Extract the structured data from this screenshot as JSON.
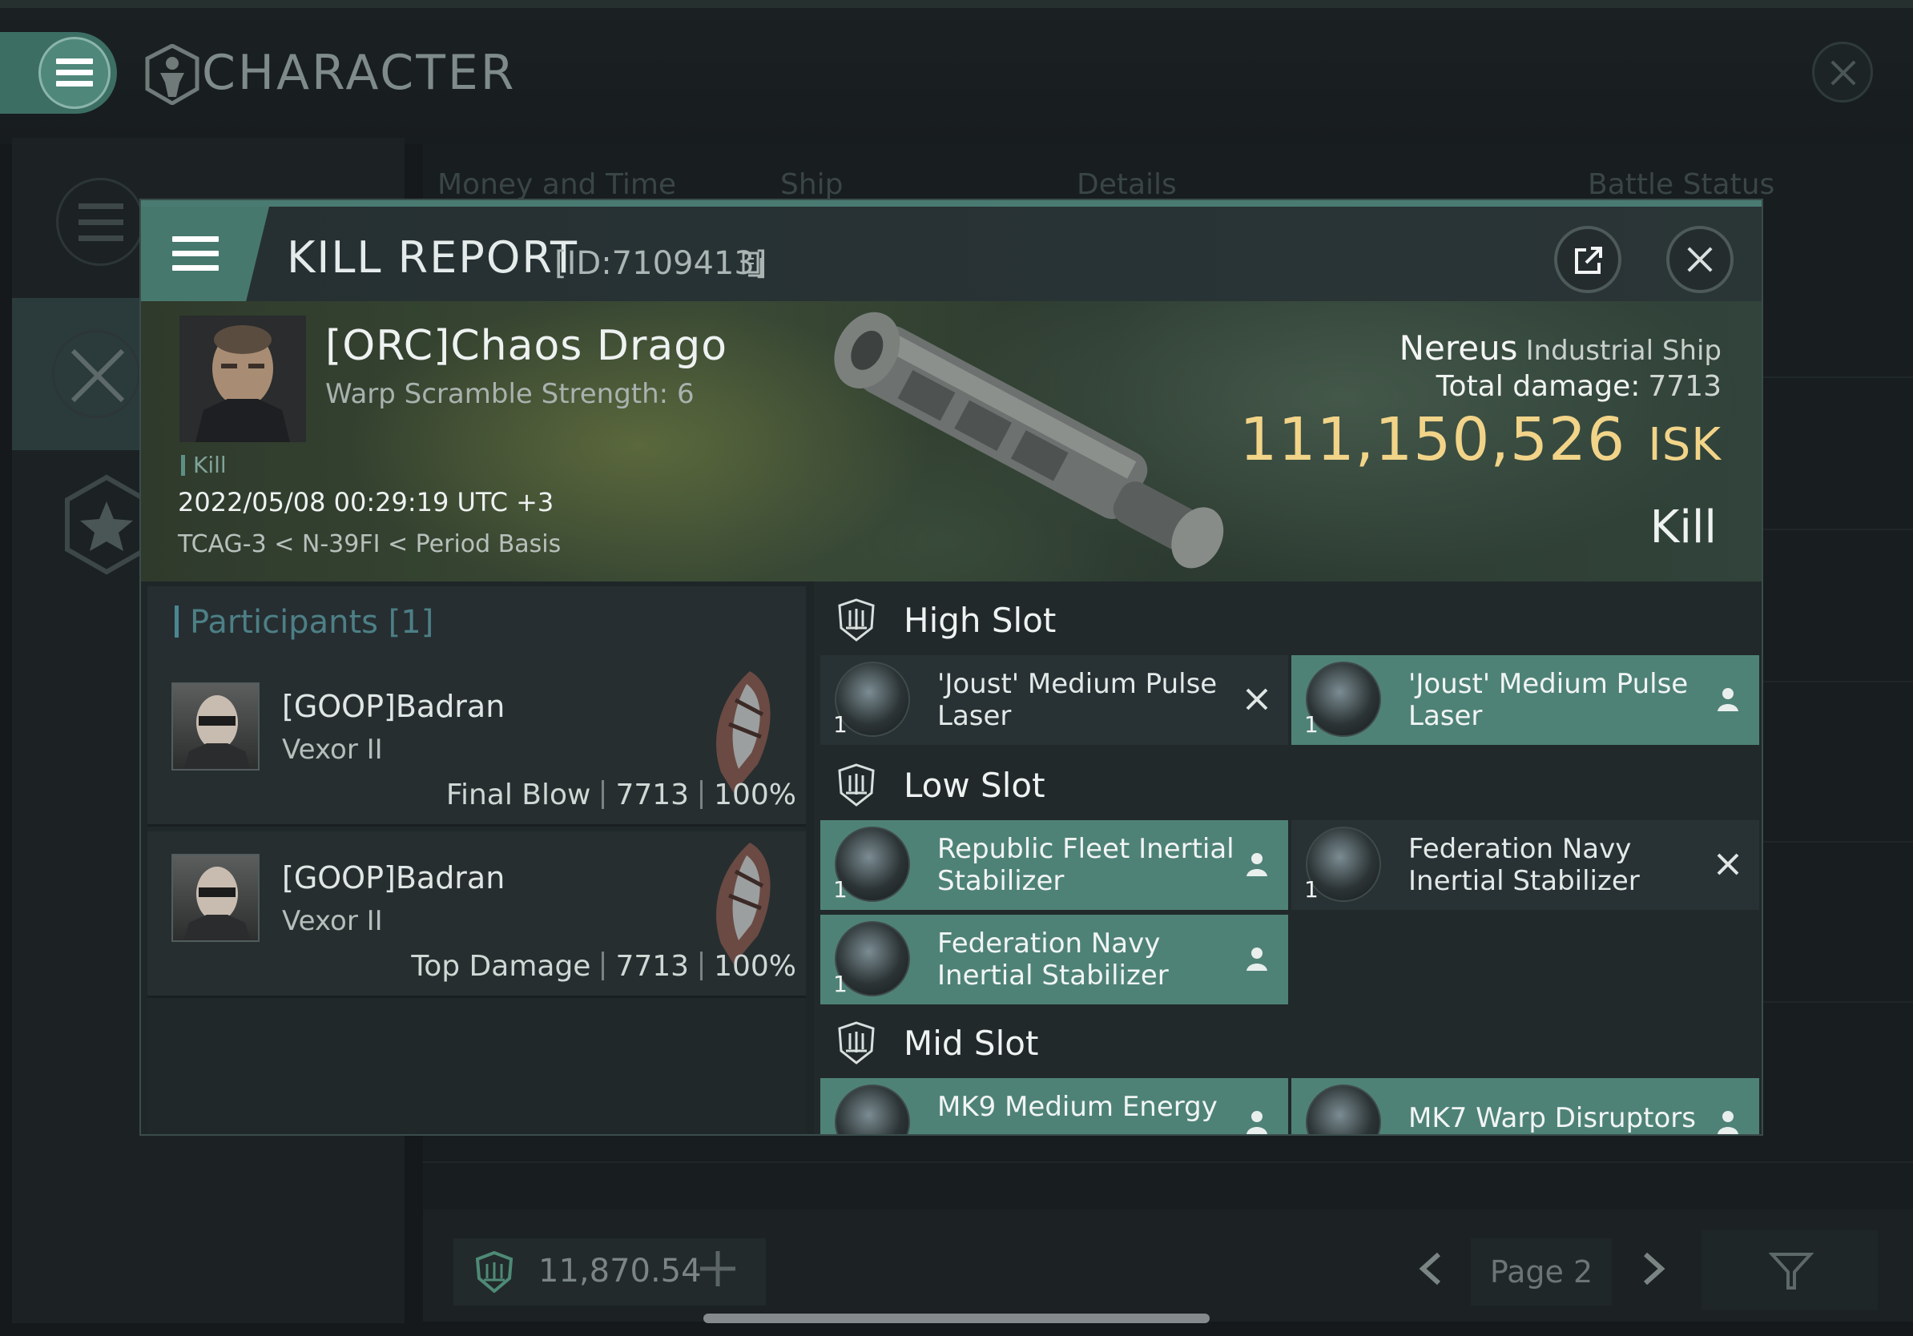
{
  "window": {
    "title": "CHARACTER"
  },
  "background": {
    "tabs": [
      "Money and Time",
      "Ship",
      "Details",
      "Battle Status"
    ],
    "wallet_value": "11,870.54",
    "page_label": "Page 2"
  },
  "kill_report": {
    "title": "KILL REPORT",
    "id_label": "[ID:7109413]",
    "victim": {
      "name": "[ORC]Chaos Drago",
      "subtitle": "Warp Scramble Strength: 6",
      "tag": "Kill",
      "datetime": "2022/05/08 00:29:19 UTC +3",
      "location": "TCAG-3 < N-39FI < Period Basis"
    },
    "ship": {
      "name": "Nereus",
      "class": "Industrial Ship",
      "total_damage_label": "Total damage:",
      "total_damage_value": "7713",
      "isk_value": "111,150,526",
      "isk_unit": "ISK",
      "result": "Kill"
    },
    "participants": {
      "title": "Participants [1]",
      "rows": [
        {
          "name": "[GOOP]Badran",
          "ship": "Vexor II",
          "role": "Final Blow",
          "damage": "7713",
          "percent": "100%"
        },
        {
          "name": "[GOOP]Badran",
          "ship": "Vexor II",
          "role": "Top Damage",
          "damage": "7713",
          "percent": "100%"
        }
      ]
    },
    "slots": {
      "high": {
        "label": "High Slot",
        "items": [
          {
            "name": "'Joust' Medium Pulse Laser",
            "qty": "1",
            "state": "destroyed"
          },
          {
            "name": "'Joust' Medium Pulse Laser",
            "qty": "1",
            "state": "dropped"
          }
        ]
      },
      "low": {
        "label": "Low Slot",
        "items": [
          {
            "name": "Republic Fleet Inertial Stabilizer",
            "qty": "1",
            "state": "dropped"
          },
          {
            "name": "Federation Navy Inertial Stabilizer",
            "qty": "1",
            "state": "destroyed"
          },
          {
            "name": "Federation Navy Inertial Stabilizer",
            "qty": "1",
            "state": "dropped"
          }
        ]
      },
      "mid": {
        "label": "Mid Slot",
        "items": [
          {
            "name": "MK9 Medium Energy",
            "qty": "",
            "state": "dropped"
          },
          {
            "name": "MK7 Warp Disruptors",
            "qty": "",
            "state": "dropped"
          }
        ]
      }
    }
  },
  "colors": {
    "accent": "#4f8277",
    "isk_gold": "#f2d489",
    "participants_title": "#4d7f86"
  },
  "icons": {
    "menu": "hamburger-icon",
    "close": "close-icon",
    "share": "external-link-icon",
    "copy": "copy-icon",
    "slot": "slot-shield-icon",
    "dropped": "person-icon",
    "destroyed": "x-icon"
  }
}
